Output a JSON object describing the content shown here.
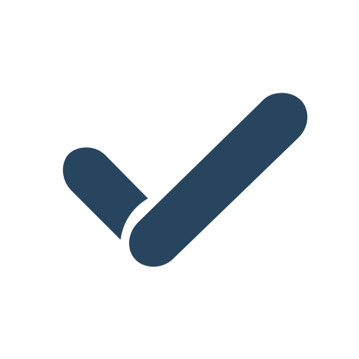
{
  "icon": {
    "name": "checkmark-icon",
    "color": "#27455f",
    "background": "#ffffff"
  }
}
